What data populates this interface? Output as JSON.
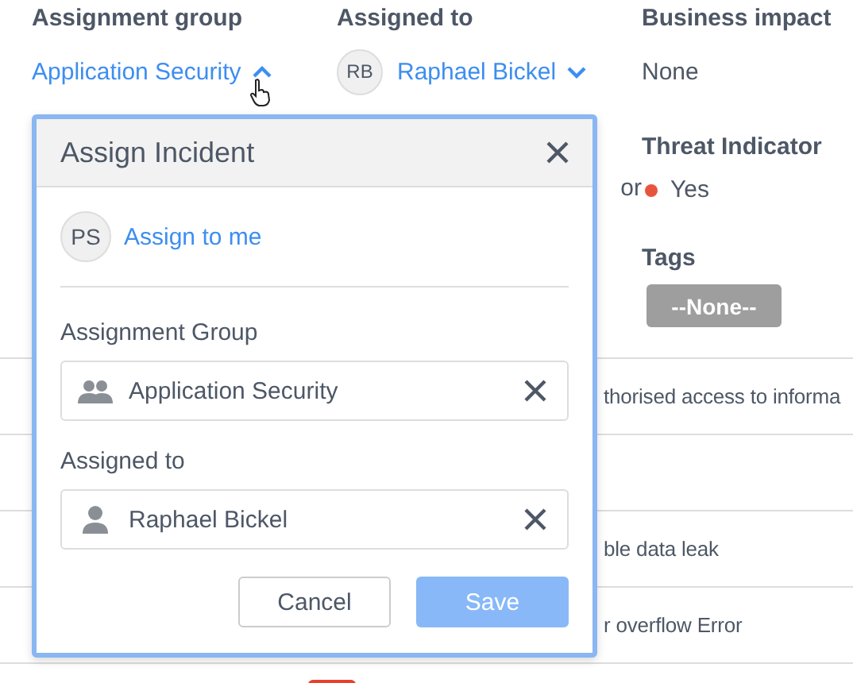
{
  "fields": [
    {
      "label": "Assignment group",
      "value": "Application Security",
      "kind": "dropdown",
      "expanded": true
    },
    {
      "label": "Assigned to",
      "value": "Raphael Bickel",
      "avatar": "RB",
      "kind": "user",
      "expanded": false
    },
    {
      "label": "Business impact",
      "value": "None",
      "kind": "text"
    }
  ],
  "threat_indicator": {
    "label": "Threat Indicator",
    "value": "Yes",
    "color": "#e8553e"
  },
  "tags": {
    "label": "Tags",
    "value": "--None--"
  },
  "partial_text": "or",
  "rows": [
    "thorised access to informa",
    "",
    "ble data leak",
    "r overflow Error"
  ],
  "dialog": {
    "title": "Assign Incident",
    "assign_me": {
      "avatar": "PS",
      "label": "Assign to me"
    },
    "fields": [
      {
        "label": "Assignment Group",
        "value": "Application Security",
        "kind": "group"
      },
      {
        "label": "Assigned to",
        "value": "Raphael Bickel",
        "kind": "user"
      }
    ],
    "buttons": [
      {
        "label": "Cancel",
        "kind": "secondary",
        "disabled": false
      },
      {
        "label": "Save",
        "kind": "primary",
        "disabled": true
      }
    ]
  }
}
